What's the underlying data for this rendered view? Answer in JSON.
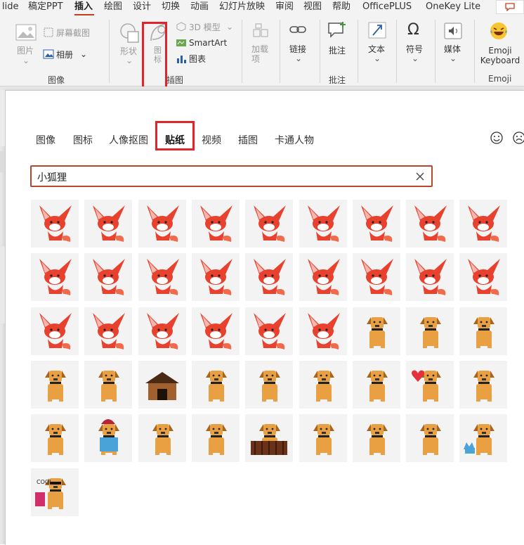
{
  "menubar": {
    "items": [
      "lide",
      "稿定PPT",
      "插入",
      "绘图",
      "设计",
      "切换",
      "动画",
      "幻灯片放映",
      "审阅",
      "视图",
      "帮助",
      "OfficePLUS",
      "OneKey Lite"
    ],
    "active_index": 2
  },
  "ribbon": {
    "pictures": "图片",
    "screenshot": "屏幕截图",
    "album": "相册",
    "group_images": "图像",
    "shapes": "形状",
    "icons": "图标",
    "model3d": "3D 模型",
    "smartart": "SmartArt",
    "chart": "图表",
    "group_illustrations": "插图",
    "addins": "加载项",
    "link": "链接",
    "comment": "批注",
    "group_comments": "批注",
    "text": "文本",
    "symbols": "符号",
    "media": "媒体",
    "emoji": "Emoji Keyboard",
    "group_emoji": "Emoji"
  },
  "panel": {
    "tabs": [
      "图像",
      "图标",
      "人像抠图",
      "贴纸",
      "视频",
      "插图",
      "卡通人物"
    ],
    "active_tab": "贴纸",
    "search": {
      "value": "小狐狸"
    }
  },
  "stickers": {
    "rows": [
      [
        "fox",
        "fox",
        "fox",
        "fox",
        "fox",
        "fox",
        "fox",
        "fox",
        "fox"
      ],
      [
        "fox",
        "fox",
        "fox",
        "fox",
        "fox",
        "fox",
        "fox",
        "fox",
        "fox"
      ],
      [
        "fox",
        "fox",
        "fox",
        "fox",
        "fox",
        "fox",
        "dog",
        "dog",
        "dog"
      ],
      [
        "dog",
        "dog",
        "doghouse",
        "dog",
        "dog",
        "dog",
        "dog",
        "dog-heart",
        "dog"
      ],
      [
        "dog",
        "dog-hat",
        "dog",
        "dog",
        "dog-fence",
        "dog",
        "dog",
        "dog",
        "dog-cat"
      ],
      [
        "dog-cool"
      ]
    ],
    "colors": {
      "fox": "#e8412e",
      "dog": "#e8a043",
      "tile_bg": "#f3f3f3"
    }
  },
  "colors": {
    "accent": "#c43e1c",
    "highlight": "#e2232a",
    "search_border": "#b7472a"
  }
}
